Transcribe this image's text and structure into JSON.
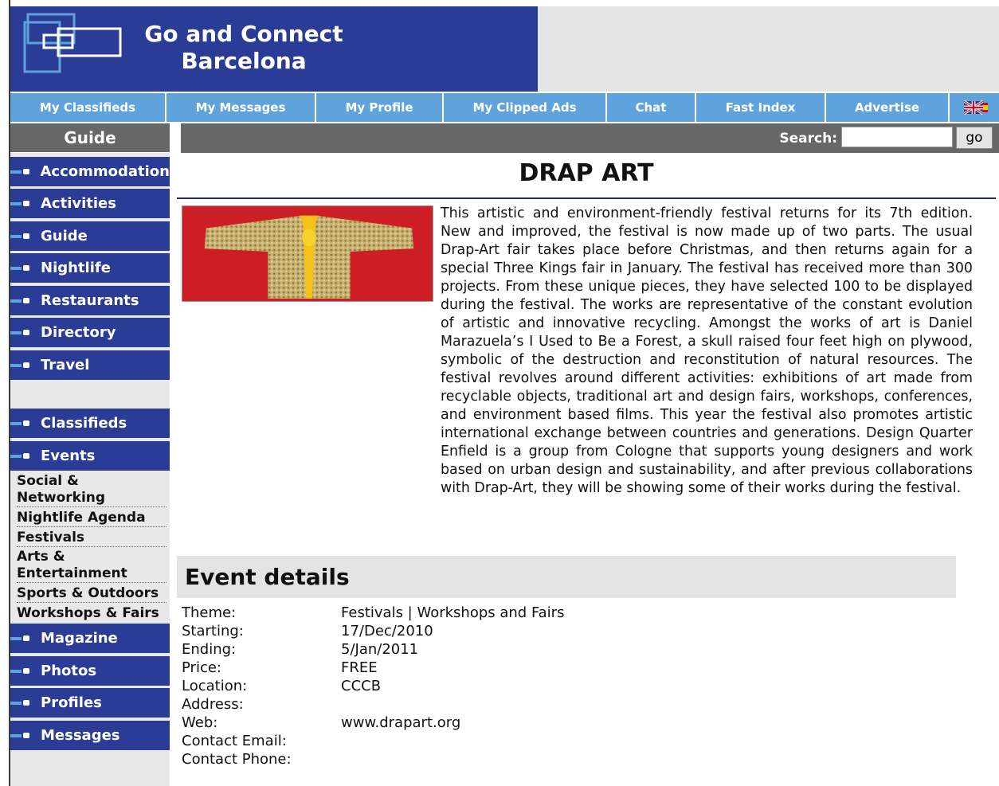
{
  "site": {
    "title_line1": "Go and Connect",
    "title_line2": "Barcelona"
  },
  "nav": [
    {
      "label": "My Classifieds"
    },
    {
      "label": "My Messages"
    },
    {
      "label": "My Profile"
    },
    {
      "label": "My Clipped Ads"
    },
    {
      "label": "Chat"
    },
    {
      "label": "Fast Index"
    },
    {
      "label": "Advertise"
    }
  ],
  "guide_label": "Guide",
  "search": {
    "label": "Search:",
    "value": "",
    "button": "go"
  },
  "sidebar": {
    "guide_items": [
      {
        "label": "Accommodation"
      },
      {
        "label": "Activities"
      },
      {
        "label": "Guide"
      },
      {
        "label": "Nightlife"
      },
      {
        "label": "Restaurants"
      },
      {
        "label": "Directory"
      },
      {
        "label": "Travel"
      }
    ],
    "classifieds": "Classifieds",
    "events": "Events",
    "event_subitems": [
      {
        "label": "Social & Networking"
      },
      {
        "label": "Nightlife Agenda"
      },
      {
        "label": "Festivals"
      },
      {
        "label": "Arts & Entertainment"
      },
      {
        "label": "Sports & Outdoors"
      },
      {
        "label": "Workshops & Fairs"
      }
    ],
    "more_items": [
      {
        "label": "Magazine"
      },
      {
        "label": "Photos"
      },
      {
        "label": "Profiles"
      },
      {
        "label": "Messages"
      }
    ]
  },
  "event": {
    "title": "DRAP ART",
    "description": "This artistic and environment-friendly festival returns for its 7th edition. New and improved, the festival is now made up of two parts. The usual Drap-Art fair takes place before Christmas, and then returns again for a special Three Kings fair in January. The festival has received more than 300 projects. From these unique pieces, they have selected 100 to be displayed during the festival. The works are representative of the constant evolution of artistic and innovative recycling. Amongst the works of art is Daniel Marazuela’s I Used to Be a Forest, a skull raised four feet high on plywood, symbolic of the destruction and reconstitution of natural resources. The festival revolves around different activities: exhibitions of art made from recyclable objects, traditional art and design fairs, workshops, conferences, and environment based films. This year the festival also promotes artistic international exchange between countries and generations. Design Quarter Enfield is a group from Cologne that supports young designers and work based on urban design and sustainability, and after previous collaborations with Drap-Art, they will be showing some of their works during the festival.",
    "details_heading": "Event details",
    "details": [
      {
        "label": "Theme:",
        "value": "Festivals | Workshops and Fairs"
      },
      {
        "label": "Starting:",
        "value": "17/Dec/2010"
      },
      {
        "label": "Ending:",
        "value": "5/Jan/2011"
      },
      {
        "label": "Price:",
        "value": "FREE"
      },
      {
        "label": "Location:",
        "value": "CCCB"
      },
      {
        "label": "Address:",
        "value": ""
      },
      {
        "label": "Web:",
        "value": "www.drapart.org"
      },
      {
        "label": "Contact Email:",
        "value": ""
      },
      {
        "label": "Contact Phone:",
        "value": ""
      }
    ]
  },
  "colors": {
    "header_blue": "#2a3c96",
    "nav_blue": "#5ea3dc",
    "bar_gray": "#676767"
  },
  "icons": [
    "logo-icon",
    "uk-flag-icon",
    "spain-flag-icon",
    "bullet-icon"
  ]
}
